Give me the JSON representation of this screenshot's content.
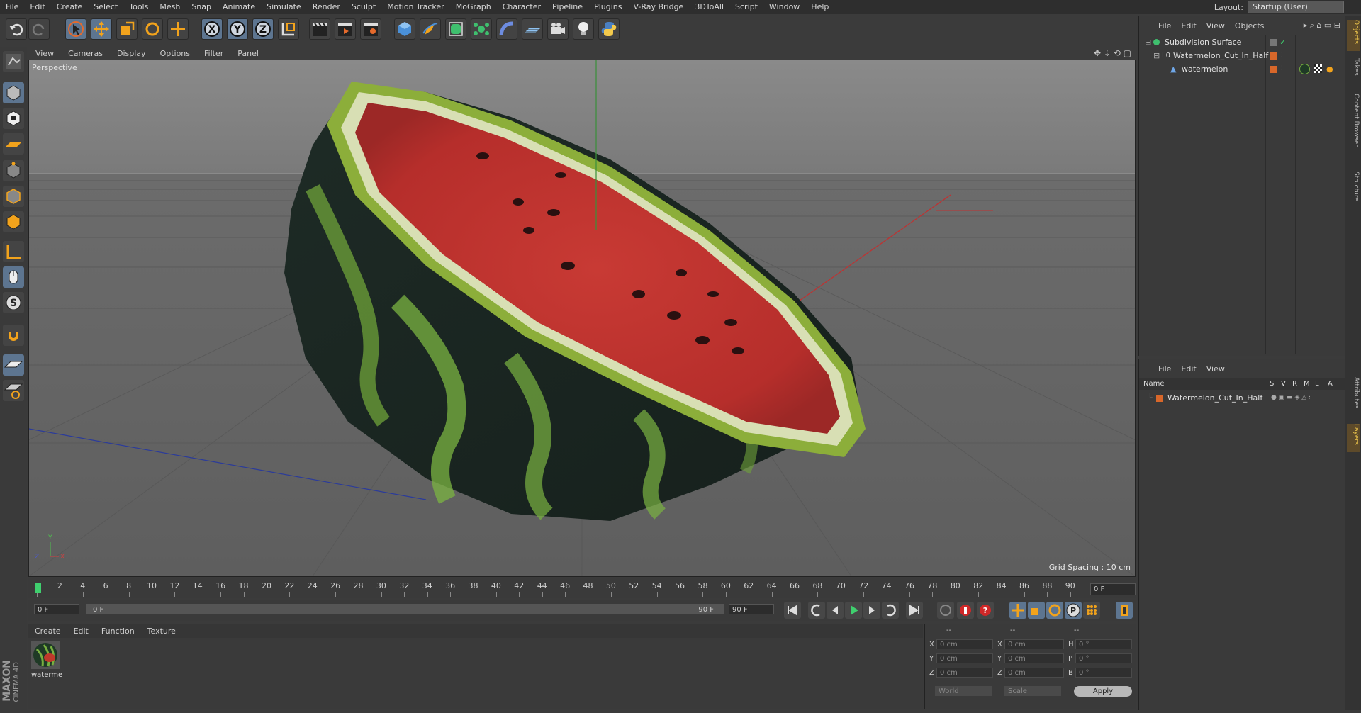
{
  "menubar": {
    "items": [
      "File",
      "Edit",
      "Create",
      "Select",
      "Tools",
      "Mesh",
      "Snap",
      "Animate",
      "Simulate",
      "Render",
      "Sculpt",
      "Motion Tracker",
      "MoGraph",
      "Character",
      "Pipeline",
      "Plugins",
      "V-Ray Bridge",
      "3DToAll",
      "Script",
      "Window",
      "Help"
    ],
    "layout_label": "Layout:",
    "layout_value": "Startup (User)"
  },
  "viewport": {
    "menu": [
      "View",
      "Cameras",
      "Display",
      "Options",
      "Filter",
      "Panel"
    ],
    "label": "Perspective",
    "grid_spacing": "Grid Spacing : 10 cm"
  },
  "timeline": {
    "ticks": [
      "0",
      "2",
      "4",
      "6",
      "8",
      "10",
      "12",
      "14",
      "16",
      "18",
      "20",
      "22",
      "24",
      "26",
      "28",
      "30",
      "32",
      "34",
      "36",
      "38",
      "40",
      "42",
      "44",
      "46",
      "48",
      "50",
      "52",
      "54",
      "56",
      "58",
      "60",
      "62",
      "64",
      "66",
      "68",
      "70",
      "72",
      "74",
      "76",
      "78",
      "80",
      "82",
      "84",
      "86",
      "88",
      "90"
    ],
    "current_frame": "0 F"
  },
  "transport": {
    "start_field": "0 F",
    "range_start": "0 F",
    "range_end": "90 F",
    "end_field": "90 F"
  },
  "material_panel": {
    "menu": [
      "Create",
      "Edit",
      "Function",
      "Texture"
    ],
    "material_name": "waterme"
  },
  "branding": {
    "maxon": "MAXON",
    "c4d": "CINEMA 4D"
  },
  "coords": {
    "headers": [
      "--",
      "--",
      "--"
    ],
    "rows": [
      {
        "l1": "X",
        "v1": "0 cm",
        "l2": "X",
        "v2": "0 cm",
        "l3": "H",
        "v3": "0 °"
      },
      {
        "l1": "Y",
        "v1": "0 cm",
        "l2": "Y",
        "v2": "0 cm",
        "l3": "P",
        "v3": "0 °"
      },
      {
        "l1": "Z",
        "v1": "0 cm",
        "l2": "Z",
        "v2": "0 cm",
        "l3": "B",
        "v3": "0 °"
      }
    ],
    "world": "World",
    "scale": "Scale",
    "apply": "Apply"
  },
  "objects_panel": {
    "menu": [
      "File",
      "Edit",
      "View",
      "Objects"
    ],
    "items": [
      "Subdivision Surface",
      "Watermelon_Cut_In_Half",
      "watermelon"
    ]
  },
  "layers_panel": {
    "menu": [
      "File",
      "Edit",
      "View"
    ],
    "col_name": "Name",
    "cols": [
      "S",
      "V",
      "R",
      "M",
      "L",
      "A"
    ],
    "items": [
      "Watermelon_Cut_In_Half"
    ]
  },
  "side_tabs": [
    "Objects",
    "Takes",
    "Content Browser",
    "Structure",
    "Attributes",
    "Layers"
  ],
  "colors": {
    "accent_blue": "#5d7590",
    "orange": "#d8672a",
    "viewport_bg": "#6d6d6d"
  }
}
